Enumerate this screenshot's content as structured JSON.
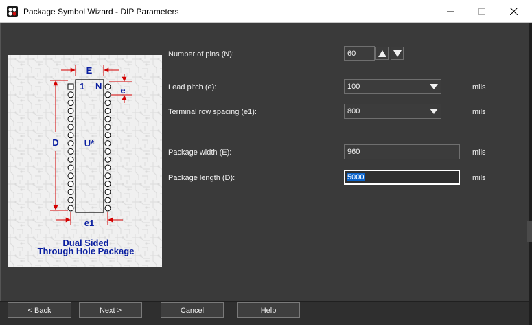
{
  "window": {
    "title": "Package Symbol Wizard - DIP Parameters"
  },
  "diagram": {
    "label_E": "E",
    "label_e": "e",
    "label_D": "D",
    "label_1": "1",
    "label_N": "N",
    "label_U": "U*",
    "label_e1": "e1",
    "caption_line1": "Dual Sided",
    "caption_line2": "Through Hole Package"
  },
  "form": {
    "num_pins": {
      "label": "Number of pins (N):",
      "value": "60"
    },
    "lead_pitch": {
      "label": "Lead pitch (e):",
      "value": "100",
      "units": "mils"
    },
    "row_spacing": {
      "label": "Terminal row spacing (e1):",
      "value": "800",
      "units": "mils"
    },
    "pkg_width": {
      "label": "Package width (E):",
      "value": "960",
      "units": "mils"
    },
    "pkg_length": {
      "label": "Package length (D):",
      "value": "5000",
      "units": "mils"
    }
  },
  "buttons": {
    "back": "< Back",
    "next": "Next >",
    "cancel": "Cancel",
    "help": "Help"
  },
  "colors": {
    "dimension": "#d40000",
    "diagram_text": "#0a1fa0",
    "selection": "#0a62c9"
  }
}
